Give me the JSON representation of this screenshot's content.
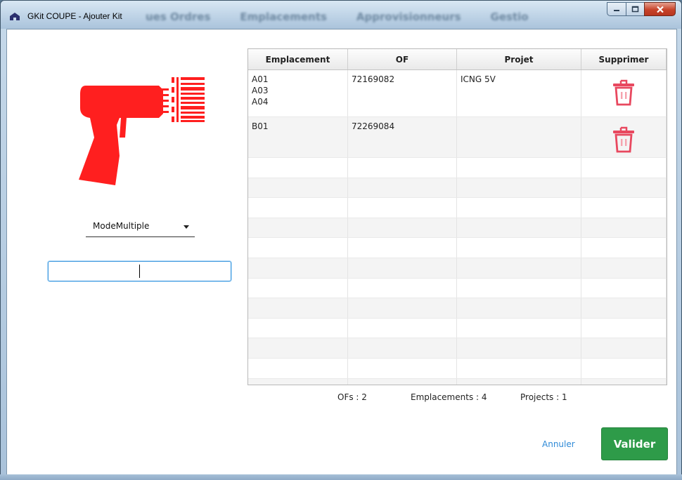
{
  "window": {
    "title": "GKit COUPE - Ajouter Kit",
    "background_menu": [
      "ues Ordres",
      "Emplacements",
      "Approvisionneurs",
      "Gestio"
    ]
  },
  "left_panel": {
    "mode_select_value": "ModeMultiple",
    "scan_input_value": ""
  },
  "table": {
    "headers": [
      "Emplacement",
      "OF",
      "Projet",
      "Supprimer"
    ],
    "rows": [
      {
        "emplacement": "A01\nA03\nA04",
        "of": "72169082",
        "projet": "ICNG 5V"
      },
      {
        "emplacement": "B01",
        "of": "72269084",
        "projet": ""
      }
    ]
  },
  "summary": {
    "ofs": "OFs : 2",
    "emplacements": "Emplacements : 4",
    "projects": "Projects : 1"
  },
  "actions": {
    "cancel_label": "Annuler",
    "validate_label": "Valider"
  },
  "colors": {
    "accent_red": "#ff1f1f",
    "trash_red": "#e8485f",
    "validate_green": "#2e9b49",
    "link_blue": "#2e8ad7",
    "input_focus": "#3a96dd"
  },
  "icons": {
    "app": "home-icon",
    "scanner": "barcode-scanner-icon",
    "delete": "trash-icon"
  }
}
